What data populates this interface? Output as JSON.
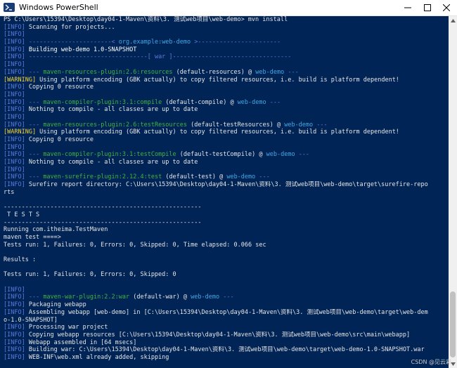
{
  "window": {
    "title": "Windows PowerShell",
    "icon": "powershell-icon",
    "controls": {
      "minimize": "—",
      "maximize": "☐",
      "close": "✕"
    }
  },
  "console": {
    "lines": [
      {
        "segs": [
          {
            "t": "PS C:\\Users\\15394\\Desktop\\day04-1-Maven\\资料\\3. 测试web项目\\web-demo> mvn install",
            "c": "plain"
          }
        ]
      },
      {
        "segs": [
          {
            "t": "[INFO]",
            "c": "info"
          },
          {
            "t": " Scanning for projects...",
            "c": "plain"
          }
        ]
      },
      {
        "segs": [
          {
            "t": "[INFO]",
            "c": "info"
          }
        ]
      },
      {
        "segs": [
          {
            "t": "[INFO]",
            "c": "info"
          },
          {
            "t": " -----------------------< ",
            "c": "sep"
          },
          {
            "t": "org.example:web-demo",
            "c": "proj"
          },
          {
            "t": " >-----------------------",
            "c": "sep"
          }
        ]
      },
      {
        "segs": [
          {
            "t": "[INFO]",
            "c": "info"
          },
          {
            "t": " Building web-demo 1.0-SNAPSHOT",
            "c": "bold"
          }
        ]
      },
      {
        "segs": [
          {
            "t": "[INFO]",
            "c": "info"
          },
          {
            "t": " ---------------------------------[ war ]---------------------------------",
            "c": "sep"
          }
        ]
      },
      {
        "segs": [
          {
            "t": "[INFO]",
            "c": "info"
          }
        ]
      },
      {
        "segs": [
          {
            "t": "[INFO]",
            "c": "info"
          },
          {
            "t": " --- ",
            "c": "sep"
          },
          {
            "t": "maven-resources-plugin:2.6:resources",
            "c": "plugin"
          },
          {
            "t": " (default-resources)",
            "c": "plain"
          },
          {
            "t": " @ ",
            "c": "plain"
          },
          {
            "t": "web-demo",
            "c": "proj"
          },
          {
            "t": " ---",
            "c": "sep"
          }
        ]
      },
      {
        "segs": [
          {
            "t": "[WARNING]",
            "c": "warn"
          },
          {
            "t": " Using platform encoding (GBK actually) to copy filtered resources, i.e. build is platform dependent!",
            "c": "plain"
          }
        ]
      },
      {
        "segs": [
          {
            "t": "[INFO]",
            "c": "info"
          },
          {
            "t": " Copying 0 resource",
            "c": "plain"
          }
        ]
      },
      {
        "segs": [
          {
            "t": "[INFO]",
            "c": "info"
          }
        ]
      },
      {
        "segs": [
          {
            "t": "[INFO]",
            "c": "info"
          },
          {
            "t": " --- ",
            "c": "sep"
          },
          {
            "t": "maven-compiler-plugin:3.1:compile",
            "c": "plugin"
          },
          {
            "t": " (default-compile)",
            "c": "plain"
          },
          {
            "t": " @ ",
            "c": "plain"
          },
          {
            "t": "web-demo",
            "c": "proj"
          },
          {
            "t": " ---",
            "c": "sep"
          }
        ]
      },
      {
        "segs": [
          {
            "t": "[INFO]",
            "c": "info"
          },
          {
            "t": " Nothing to compile - all classes are up to date",
            "c": "plain"
          }
        ]
      },
      {
        "segs": [
          {
            "t": "[INFO]",
            "c": "info"
          }
        ]
      },
      {
        "segs": [
          {
            "t": "[INFO]",
            "c": "info"
          },
          {
            "t": " --- ",
            "c": "sep"
          },
          {
            "t": "maven-resources-plugin:2.6:testResources",
            "c": "plugin"
          },
          {
            "t": " (default-testResources)",
            "c": "plain"
          },
          {
            "t": " @ ",
            "c": "plain"
          },
          {
            "t": "web-demo",
            "c": "proj"
          },
          {
            "t": " ---",
            "c": "sep"
          }
        ]
      },
      {
        "segs": [
          {
            "t": "[WARNING]",
            "c": "warn"
          },
          {
            "t": " Using platform encoding (GBK actually) to copy filtered resources, i.e. build is platform dependent!",
            "c": "plain"
          }
        ]
      },
      {
        "segs": [
          {
            "t": "[INFO]",
            "c": "info"
          },
          {
            "t": " Copying 0 resource",
            "c": "plain"
          }
        ]
      },
      {
        "segs": [
          {
            "t": "[INFO]",
            "c": "info"
          }
        ]
      },
      {
        "segs": [
          {
            "t": "[INFO]",
            "c": "info"
          },
          {
            "t": " --- ",
            "c": "sep"
          },
          {
            "t": "maven-compiler-plugin:3.1:testCompile",
            "c": "plugin"
          },
          {
            "t": " (default-testCompile)",
            "c": "plain"
          },
          {
            "t": " @ ",
            "c": "plain"
          },
          {
            "t": "web-demo",
            "c": "proj"
          },
          {
            "t": " ---",
            "c": "sep"
          }
        ]
      },
      {
        "segs": [
          {
            "t": "[INFO]",
            "c": "info"
          },
          {
            "t": " Nothing to compile - all classes are up to date",
            "c": "plain"
          }
        ]
      },
      {
        "segs": [
          {
            "t": "[INFO]",
            "c": "info"
          }
        ]
      },
      {
        "segs": [
          {
            "t": "[INFO]",
            "c": "info"
          },
          {
            "t": " --- ",
            "c": "sep"
          },
          {
            "t": "maven-surefire-plugin:2.12.4:test",
            "c": "plugin"
          },
          {
            "t": " (default-test)",
            "c": "plain"
          },
          {
            "t": " @ ",
            "c": "plain"
          },
          {
            "t": "web-demo",
            "c": "proj"
          },
          {
            "t": " ---",
            "c": "sep"
          }
        ]
      },
      {
        "segs": [
          {
            "t": "[INFO]",
            "c": "info"
          },
          {
            "t": " Surefire report directory: C:\\Users\\15394\\Desktop\\day04-1-Maven\\资料\\3. 测试web项目\\web-demo\\target\\surefire-repo",
            "c": "plain"
          }
        ]
      },
      {
        "segs": [
          {
            "t": "rts",
            "c": "plain"
          }
        ]
      },
      {
        "segs": [
          {
            "t": "",
            "c": "plain"
          }
        ]
      },
      {
        "segs": [
          {
            "t": "-------------------------------------------------------",
            "c": "plain"
          }
        ]
      },
      {
        "segs": [
          {
            "t": " T E S T S",
            "c": "plain"
          }
        ]
      },
      {
        "segs": [
          {
            "t": "-------------------------------------------------------",
            "c": "plain"
          }
        ]
      },
      {
        "segs": [
          {
            "t": "Running com.itheima.TestMaven",
            "c": "plain"
          }
        ]
      },
      {
        "segs": [
          {
            "t": "maven test ====>",
            "c": "plain"
          }
        ]
      },
      {
        "segs": [
          {
            "t": "Tests run: 1, Failures: 0, Errors: 0, Skipped: 0, Time elapsed: 0.066 sec",
            "c": "plain"
          }
        ]
      },
      {
        "segs": [
          {
            "t": "",
            "c": "plain"
          }
        ]
      },
      {
        "segs": [
          {
            "t": "Results :",
            "c": "plain"
          }
        ]
      },
      {
        "segs": [
          {
            "t": "",
            "c": "plain"
          }
        ]
      },
      {
        "segs": [
          {
            "t": "Tests run: 1, Failures: 0, Errors: 0, Skipped: 0",
            "c": "plain"
          }
        ]
      },
      {
        "segs": [
          {
            "t": "",
            "c": "plain"
          }
        ]
      },
      {
        "segs": [
          {
            "t": "[INFO]",
            "c": "info"
          }
        ]
      },
      {
        "segs": [
          {
            "t": "[INFO]",
            "c": "info"
          },
          {
            "t": " --- ",
            "c": "sep"
          },
          {
            "t": "maven-war-plugin:2.2:war",
            "c": "plugin"
          },
          {
            "t": " (default-war)",
            "c": "plain"
          },
          {
            "t": " @ ",
            "c": "plain"
          },
          {
            "t": "web-demo",
            "c": "proj"
          },
          {
            "t": " ---",
            "c": "sep"
          }
        ]
      },
      {
        "segs": [
          {
            "t": "[INFO]",
            "c": "info"
          },
          {
            "t": " Packaging webapp",
            "c": "plain"
          }
        ]
      },
      {
        "segs": [
          {
            "t": "[INFO]",
            "c": "info"
          },
          {
            "t": " Assembling webapp [web-demo] in [C:\\Users\\15394\\Desktop\\day04-1-Maven\\资料\\3. 测试web项目\\web-demo\\target\\web-dem",
            "c": "plain"
          }
        ]
      },
      {
        "segs": [
          {
            "t": "o-1.0-SNAPSHOT]",
            "c": "plain"
          }
        ]
      },
      {
        "segs": [
          {
            "t": "[INFO]",
            "c": "info"
          },
          {
            "t": " Processing war project",
            "c": "plain"
          }
        ]
      },
      {
        "segs": [
          {
            "t": "[INFO]",
            "c": "info"
          },
          {
            "t": " Copying webapp resources [C:\\Users\\15394\\Desktop\\day04-1-Maven\\资料\\3. 测试web项目\\web-demo\\src\\main\\webapp]",
            "c": "plain"
          }
        ]
      },
      {
        "segs": [
          {
            "t": "[INFO]",
            "c": "info"
          },
          {
            "t": " Webapp assembled in [64 msecs]",
            "c": "plain"
          }
        ]
      },
      {
        "segs": [
          {
            "t": "[INFO]",
            "c": "info"
          },
          {
            "t": " Building war: C:\\Users\\15394\\Desktop\\day04-1-Maven\\资料\\3. 测试web项目\\web-demo\\target\\web-demo-1.0-SNAPSHOT.war",
            "c": "plain"
          }
        ]
      },
      {
        "segs": [
          {
            "t": "[INFO]",
            "c": "info"
          },
          {
            "t": " WEB-INF\\web.xml already added, skipping",
            "c": "plain"
          }
        ]
      }
    ]
  },
  "watermark": "CSDN @见云彩",
  "colors": {
    "background": "#012456",
    "info": "#5b7bdc",
    "warning": "#f3d33f",
    "plugin": "#3fb541",
    "project": "#41a8e4",
    "text": "#e6e6e6"
  }
}
